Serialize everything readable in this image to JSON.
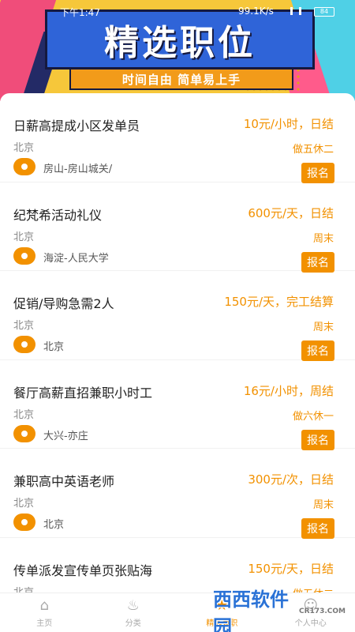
{
  "status_bar": {
    "time": "下午1:47",
    "speed": "99.1K/s",
    "battery": "84"
  },
  "banner": {
    "title": "精选职位",
    "subtitle": "时间自由 简单易上手"
  },
  "jobs": [
    {
      "title": "日薪高提成小区发单员",
      "salary": "10元/小时，日结",
      "city": "北京",
      "schedule": "做五休二",
      "area": "房山-房山城关/",
      "apply_label": "报名"
    },
    {
      "title": "纪梵希活动礼仪",
      "salary": "600元/天，日结",
      "city": "北京",
      "schedule": "周末",
      "area": "海淀-人民大学",
      "apply_label": "报名"
    },
    {
      "title": "促销/导购急需2人",
      "salary": "150元/天，完工结算",
      "city": "北京",
      "schedule": "周末",
      "area": "北京",
      "apply_label": "报名"
    },
    {
      "title": "餐厅高薪直招兼职小时工",
      "salary": "16元/小时，周结",
      "city": "北京",
      "schedule": "做六休一",
      "area": "大兴-亦庄",
      "apply_label": "报名"
    },
    {
      "title": "兼职高中英语老师",
      "salary": "300元/次，日结",
      "city": "北京",
      "schedule": "周末",
      "area": "北京",
      "apply_label": "报名"
    },
    {
      "title": "传单派发宣传单页张贴海",
      "salary": "150元/天，日结",
      "city": "北京",
      "schedule": "做五休二",
      "area": "",
      "apply_label": ""
    }
  ],
  "bottom_nav": {
    "items": [
      {
        "label": "主页",
        "icon": "home-icon"
      },
      {
        "label": "分类",
        "icon": "fire-icon"
      },
      {
        "label": "精选兼职",
        "icon": "star-icon"
      },
      {
        "label": "个人中心",
        "icon": "user-icon"
      }
    ]
  },
  "watermark": {
    "text": "西西软件园",
    "sub": "CR173.COM"
  },
  "colors": {
    "accent": "#f29100",
    "banner_blue": "#2f64d8",
    "banner_yellow": "#f6c73a"
  }
}
